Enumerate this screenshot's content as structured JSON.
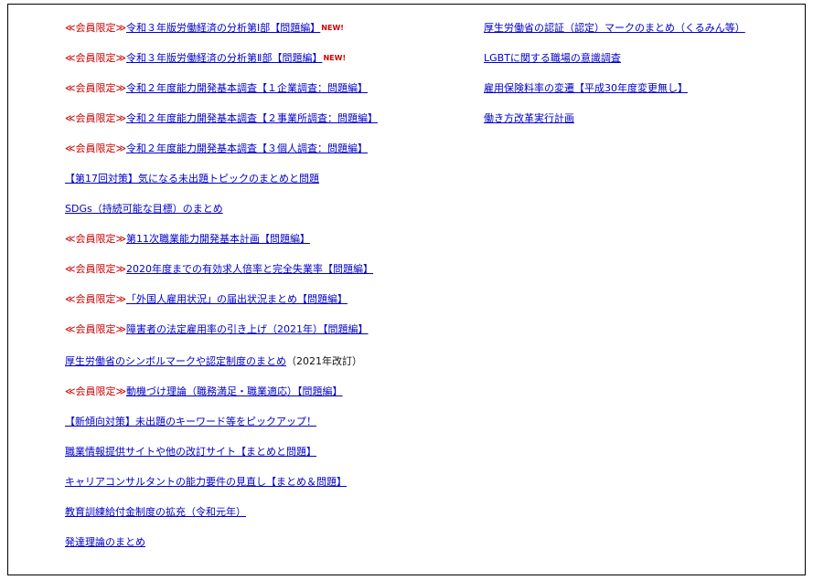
{
  "member_tag": "≪会員限定≫",
  "new_badge": "NEW!",
  "left_links": [
    {
      "member": true,
      "text": "令和３年版労働経済の分析第Ⅰ部【問題編】",
      "new": true
    },
    {
      "member": true,
      "text": "令和３年版労働経済の分析第Ⅱ部【問題編】",
      "new": true
    },
    {
      "member": true,
      "text": "令和２年度能力開発基本調査【１企業調査：問題編】",
      "new": false
    },
    {
      "member": true,
      "text": "令和２年度能力開発基本調査【２事業所調査：問題編】",
      "new": false
    },
    {
      "member": true,
      "text": "令和２年度能力開発基本調査【３個人調査：問題編】",
      "new": false
    },
    {
      "member": false,
      "text": "【第17回対策】気になる未出題トピックのまとめと問題",
      "new": false
    },
    {
      "member": false,
      "text": "SDGs（持続可能な目標）のまとめ",
      "new": false
    },
    {
      "member": true,
      "text": "第11次職業能力開発基本計画【問題編】",
      "new": false
    },
    {
      "member": true,
      "text": "2020年度までの有効求人倍率と完全失業率【問題編】",
      "new": false
    },
    {
      "member": true,
      "text": "「外国人雇用状況」の届出状況まとめ【問題編】",
      "new": false
    },
    {
      "member": true,
      "text": "障害者の法定雇用率の引き上げ（2021年）【問題編】",
      "new": false
    },
    {
      "member": false,
      "text": "厚生労働省のシンボルマークや認定制度のまとめ",
      "suffix": "（2021年改訂）",
      "new": false
    },
    {
      "member": true,
      "text": "動機づけ理論（職務満足・職業適応）【問題編】",
      "new": false
    },
    {
      "member": false,
      "text": "【新傾向対策】未出題のキーワード等をピックアップ！",
      "new": false
    },
    {
      "member": false,
      "text": "職業情報提供サイトや他の改訂サイト【まとめと問題】",
      "new": false
    },
    {
      "member": false,
      "text": "キャリアコンサルタントの能力要件の見直し【まとめ＆問題】",
      "new": false
    },
    {
      "member": false,
      "text": "教育訓練給付金制度の拡充（令和元年）",
      "new": false
    },
    {
      "member": false,
      "text": "発達理論のまとめ",
      "new": false
    }
  ],
  "right_links": [
    {
      "text": "厚生労働省の認証（認定）マークのまとめ（くるみん等）"
    },
    {
      "text": "LGBTに関する職場の意識調査"
    },
    {
      "text": "雇用保険料率の変遷【平成30年度変更無し】"
    },
    {
      "text": "働き方改革実行計画"
    }
  ]
}
